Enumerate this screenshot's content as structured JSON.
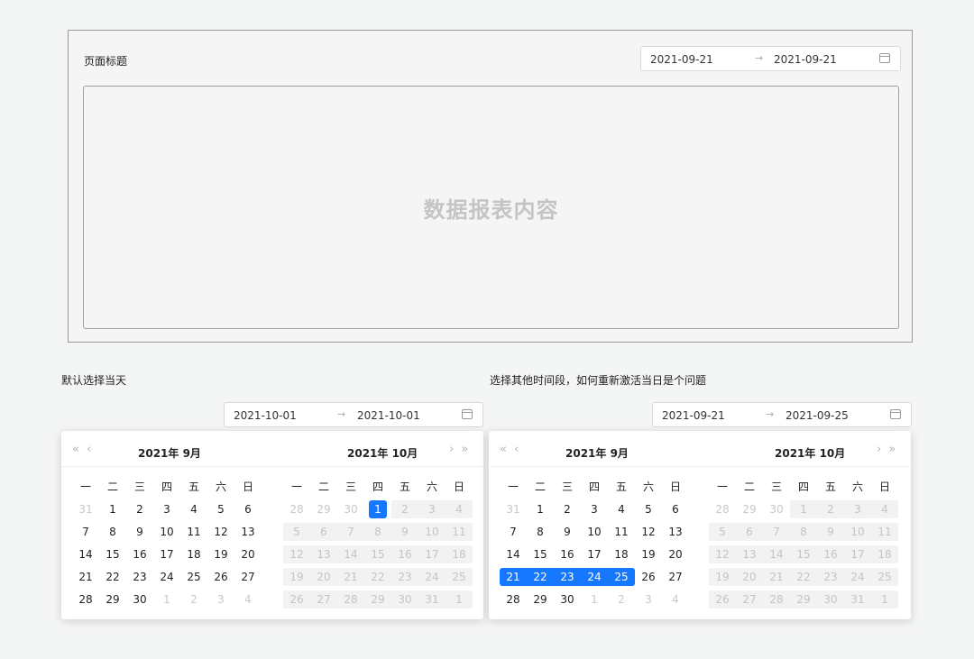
{
  "page": {
    "title": "页面标题",
    "report_placeholder": "数据报表内容",
    "range": {
      "start": "2021-09-21",
      "end": "2021-09-21",
      "arrow": "→"
    }
  },
  "left_demo": {
    "label": "默认选择当天",
    "range": {
      "start": "2021-10-01",
      "end": "2021-10-01",
      "arrow": "→"
    },
    "nav": {
      "prev": "« ‹",
      "next": "› »"
    },
    "months": [
      {
        "title": "2021年  9月",
        "weekdays": [
          "一",
          "二",
          "三",
          "四",
          "五",
          "六",
          "日"
        ],
        "weeks": [
          [
            "31",
            "1",
            "2",
            "3",
            "4",
            "5",
            "6"
          ],
          [
            "7",
            "8",
            "9",
            "10",
            "11",
            "12",
            "13"
          ],
          [
            "14",
            "15",
            "16",
            "17",
            "18",
            "19",
            "20"
          ],
          [
            "21",
            "22",
            "23",
            "24",
            "25",
            "26",
            "27"
          ],
          [
            "28",
            "29",
            "30",
            "1",
            "2",
            "3",
            "4"
          ]
        ]
      },
      {
        "title": "2021年  10月",
        "weekdays": [
          "一",
          "二",
          "三",
          "四",
          "五",
          "六",
          "日"
        ],
        "weeks": [
          [
            "28",
            "29",
            "30",
            "1",
            "2",
            "3",
            "4"
          ],
          [
            "5",
            "6",
            "7",
            "8",
            "9",
            "10",
            "11"
          ],
          [
            "12",
            "13",
            "14",
            "15",
            "16",
            "17",
            "18"
          ],
          [
            "19",
            "20",
            "21",
            "22",
            "23",
            "24",
            "25"
          ],
          [
            "26",
            "27",
            "28",
            "29",
            "30",
            "31",
            "1"
          ]
        ]
      }
    ]
  },
  "right_demo": {
    "label": "选择其他时间段，如何重新激活当日是个问题",
    "range": {
      "start": "2021-09-21",
      "end": "2021-09-25",
      "arrow": "→"
    },
    "nav": {
      "prev": "« ‹",
      "next": "› »"
    },
    "months": [
      {
        "title": "2021年  9月",
        "weekdays": [
          "一",
          "二",
          "三",
          "四",
          "五",
          "六",
          "日"
        ],
        "weeks": [
          [
            "31",
            "1",
            "2",
            "3",
            "4",
            "5",
            "6"
          ],
          [
            "7",
            "8",
            "9",
            "10",
            "11",
            "12",
            "13"
          ],
          [
            "14",
            "15",
            "16",
            "17",
            "18",
            "19",
            "20"
          ],
          [
            "21",
            "22",
            "23",
            "24",
            "25",
            "26",
            "27"
          ],
          [
            "28",
            "29",
            "30",
            "1",
            "2",
            "3",
            "4"
          ]
        ]
      },
      {
        "title": "2021年  10月",
        "weekdays": [
          "一",
          "二",
          "三",
          "四",
          "五",
          "六",
          "日"
        ],
        "weeks": [
          [
            "28",
            "29",
            "30",
            "1",
            "2",
            "3",
            "4"
          ],
          [
            "5",
            "6",
            "7",
            "8",
            "9",
            "10",
            "11"
          ],
          [
            "12",
            "13",
            "14",
            "15",
            "16",
            "17",
            "18"
          ],
          [
            "19",
            "20",
            "21",
            "22",
            "23",
            "24",
            "25"
          ],
          [
            "26",
            "27",
            "28",
            "29",
            "30",
            "31",
            "1"
          ]
        ]
      }
    ]
  },
  "colors": {
    "accent": "#1677ff",
    "disabled_bg": "#f2f2f2"
  }
}
